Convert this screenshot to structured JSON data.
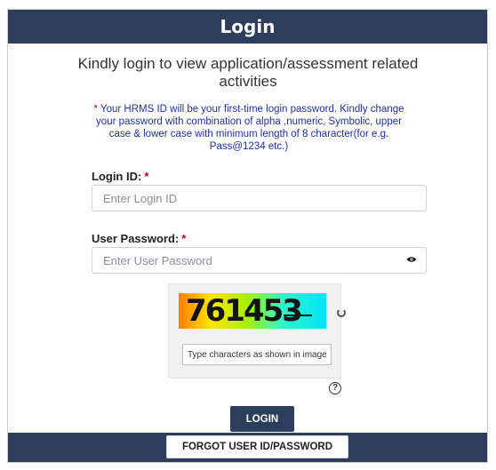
{
  "header": {
    "title": "Login"
  },
  "subtitle": "Kindly login to view application/assessment related activities",
  "notice": {
    "star": "*",
    "text": " Your HRMS ID will be your first-time login password. Kindly change your password with combination of alpha ,numeric, Symbolic, upper case & lower case with minimum length of 8 character(for e.g. Pass@1234 etc.)"
  },
  "form": {
    "login_label": "Login ID:",
    "login_placeholder": "Enter Login ID",
    "password_label": "User Password:",
    "password_placeholder": "Enter User Password",
    "required_marker": "*",
    "eye_icon": "eye-icon"
  },
  "captcha": {
    "code": "761453",
    "input_placeholder": "Type characters as shown in image",
    "help": "?",
    "refresh_icon": "refresh-icon"
  },
  "buttons": {
    "login": "LOGIN",
    "forgot": "FORGOT USER ID/PASSWORD"
  },
  "colors": {
    "header_bg": "#2d3e5c",
    "notice_text": "#1f2fa8",
    "required": "#d0021b"
  }
}
